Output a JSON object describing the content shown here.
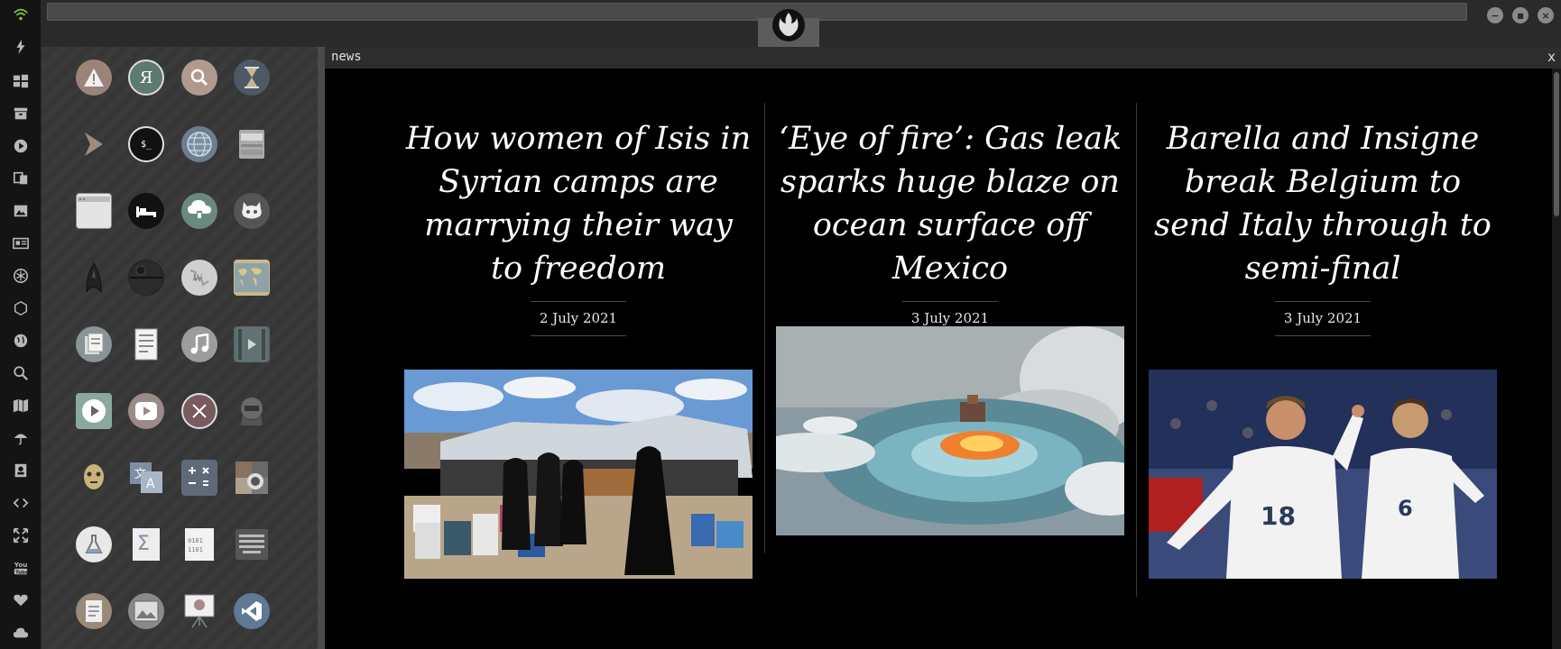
{
  "panel": {
    "title": "news",
    "close": "x"
  },
  "window_controls": {
    "minimize": "−",
    "maximize": "■",
    "close": "×"
  },
  "rail_icons": [
    "wifi-icon",
    "bolt-icon",
    "windows-icon",
    "archive-icon",
    "play-icon",
    "translate-icon",
    "image-icon",
    "newspaper-icon",
    "rebel-icon",
    "hexagon-icon",
    "globe-icon",
    "search-icon",
    "map-icon",
    "umbrella-icon",
    "contact-icon",
    "code-icon",
    "expand-icon",
    "youtube-icon",
    "heart-icon",
    "cloud-icon"
  ],
  "apps": [
    "warning",
    "yandex",
    "search",
    "hourglass",
    "arrow",
    "terminal",
    "globe",
    "printer",
    "window",
    "bed",
    "cloud-lock",
    "github",
    "starfleet",
    "death-star",
    "wikipedia",
    "world-map",
    "files",
    "document",
    "music",
    "video",
    "play",
    "youtube",
    "close",
    "rebel-pilot",
    "c3po",
    "translate",
    "calculator",
    "camera",
    "flask",
    "sigma",
    "hex-file",
    "keyboard",
    "text-file",
    "photo",
    "presentation",
    "vscode"
  ],
  "articles": [
    {
      "headline": "How women of Isis in Syrian camps are marrying their way to freedom",
      "date": "2 July 2021",
      "image": "women-in-camp-photo"
    },
    {
      "headline": "‘Eye of fire’: Gas leak sparks huge blaze on ocean surface off Mexico",
      "date": "3 July 2021",
      "image": "ocean-fire-photo"
    },
    {
      "headline": "Barella and Insigne break Belgium to send Italy through to semi-final",
      "date": "3 July 2021",
      "image": "italy-players-photo"
    }
  ],
  "colors": {
    "accent_wifi": "#79c142",
    "rail_bg": "#141414",
    "drawer_bg": "#3a3a3a",
    "panel_bg": "#000000"
  }
}
